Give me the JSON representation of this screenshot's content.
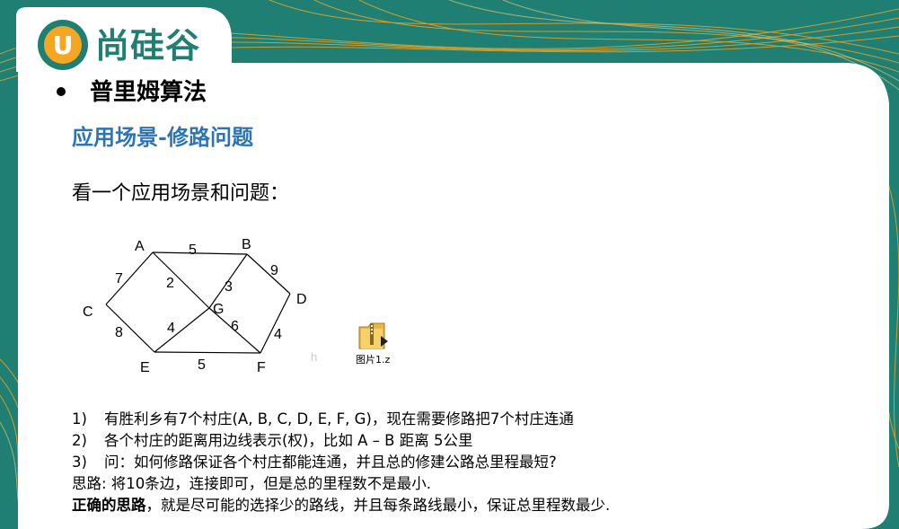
{
  "logo": {
    "badge_letter": "U",
    "text": "尚硅谷"
  },
  "heading": "普里姆算法",
  "subheading": "应用场景-修路问题",
  "intro": "看一个应用场景和问题：",
  "graph": {
    "vertices": [
      "A",
      "B",
      "C",
      "D",
      "E",
      "F",
      "G"
    ],
    "edges": [
      {
        "from": "A",
        "to": "B",
        "weight": "5"
      },
      {
        "from": "A",
        "to": "C",
        "weight": "7"
      },
      {
        "from": "A",
        "to": "G",
        "weight": "2"
      },
      {
        "from": "B",
        "to": "G",
        "weight": "3"
      },
      {
        "from": "B",
        "to": "D",
        "weight": "9"
      },
      {
        "from": "C",
        "to": "E",
        "weight": "8"
      },
      {
        "from": "E",
        "to": "G",
        "weight": "4"
      },
      {
        "from": "G",
        "to": "F",
        "weight": "6"
      },
      {
        "from": "D",
        "to": "F",
        "weight": "4"
      },
      {
        "from": "E",
        "to": "F",
        "weight": "5"
      }
    ]
  },
  "stray_text": "h",
  "file": {
    "label": "图片1.z",
    "icon": "folder-zip-icon"
  },
  "items": [
    {
      "num": "1)",
      "text": "有胜利乡有7个村庄(A, B, C, D, E, F, G)，现在需要修路把7个村庄连通"
    },
    {
      "num": "2)",
      "text": "各个村庄的距离用边线表示(权)，比如 A – B 距离 5公里"
    },
    {
      "num": "3)",
      "text": "问：如何修路保证各个村庄都能连通，并且总的修建公路总里程最短?"
    }
  ],
  "idea": "思路: 将10条边，连接即可，但是总的里程数不是最小.",
  "conclusion": {
    "bold": "正确的思路",
    "rest": "，就是尽可能的选择少的路线，并且每条路线最小，保证总里程数最少."
  },
  "colors": {
    "teal": "#1f7f72",
    "orange": "#f5a623",
    "blue_heading": "#2e74b5"
  }
}
